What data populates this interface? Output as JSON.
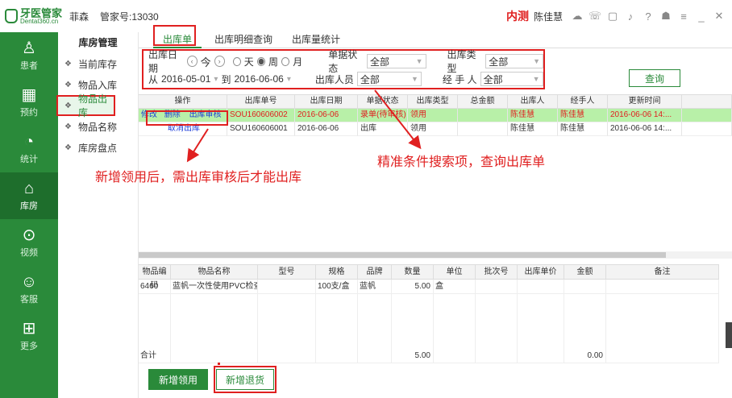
{
  "header": {
    "logo_cn": "牙医管家",
    "logo_en": "Dental360.cn",
    "user": "菲森",
    "manager_no": "管家号:13030",
    "beta": "内测",
    "operator": "陈佳慧"
  },
  "sidebar": [
    {
      "label": "患者",
      "icon": "person-icon"
    },
    {
      "label": "预约",
      "icon": "calendar-icon"
    },
    {
      "label": "统计",
      "icon": "piechart-icon"
    },
    {
      "label": "库房",
      "icon": "warehouse-icon",
      "active": true
    },
    {
      "label": "视频",
      "icon": "play-icon"
    },
    {
      "label": "客服",
      "icon": "chat-icon"
    },
    {
      "label": "更多",
      "icon": "grid-icon"
    }
  ],
  "menu": {
    "title": "库房管理",
    "items": [
      "当前库存",
      "物品入库",
      "物品出库",
      "物品名称",
      "库房盘点"
    ],
    "active": "物品出库"
  },
  "tabs": [
    "出库单",
    "出库明细查询",
    "出库量统计"
  ],
  "filter": {
    "date_label": "出库日期",
    "today": "今",
    "range_options": [
      "天",
      "周",
      "月"
    ],
    "range_selected": "周",
    "from_label": "从",
    "from": "2016-05-01",
    "to_label": "到",
    "to": "2016-06-06",
    "status_label": "单据状态",
    "status": "全部",
    "type_label": "出库类型",
    "type": "全部",
    "person_label": "出库人员",
    "person": "全部",
    "handler_label": "经 手 人",
    "handler": "全部",
    "query": "查询"
  },
  "table1": {
    "headers": [
      "操作",
      "出库单号",
      "出库日期",
      "单据状态",
      "出库类型",
      "总金额",
      "出库人",
      "经手人",
      "更新时间"
    ],
    "rows": [
      {
        "ops": [
          "修改",
          "删除",
          "出库审核"
        ],
        "no": "SOU160606002",
        "date": "2016-06-06",
        "status": "录单(待审核)",
        "type": "领用",
        "amount": "",
        "person": "陈佳慧",
        "handler": "陈佳慧",
        "updated": "2016-06-06 14:..."
      },
      {
        "ops": [
          "取消出库"
        ],
        "no": "SOU160606001",
        "date": "2016-06-06",
        "status": "出库",
        "type": "领用",
        "amount": "",
        "person": "陈佳慧",
        "handler": "陈佳慧",
        "updated": "2016-06-06 14:..."
      }
    ]
  },
  "notes": {
    "left": "新增领用后，需出库审核后才能出库",
    "right": "精准条件搜索项，查询出库单"
  },
  "table2": {
    "headers": [
      "物品编码",
      "物品名称",
      "型号",
      "规格",
      "品牌",
      "数量",
      "单位",
      "批次号",
      "出库单价",
      "金额",
      "备注"
    ],
    "rows": [
      {
        "code": "6460",
        "name": "蓝帆一次性使用PVC检查手...",
        "model": "",
        "spec": "100支/盒",
        "brand": "蓝帆",
        "qty": "5.00",
        "unit": "盒",
        "batch": "",
        "price": "",
        "amount": "",
        "remark": ""
      }
    ],
    "total_label": "合计",
    "total_qty": "5.00",
    "total_amount": "0.00"
  },
  "buttons": {
    "add_use": "新增领用",
    "add_return": "新增退货"
  },
  "colors": {
    "brand": "#2a8a3a",
    "highlight": "#e02020",
    "selected_row": "#b8f0a8"
  }
}
